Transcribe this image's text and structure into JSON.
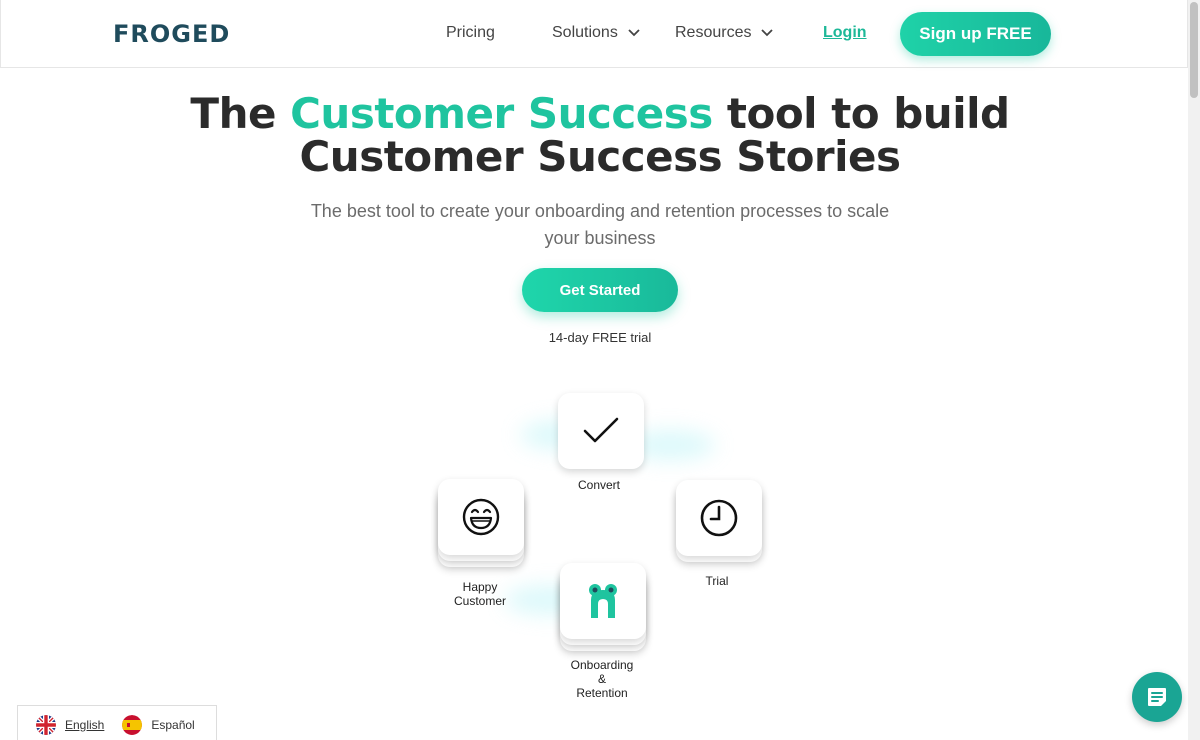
{
  "brand": {
    "name": "FROGED",
    "accent": "#1fc49f",
    "dark": "#1f4b5c"
  },
  "nav": {
    "pricing": "Pricing",
    "solutions": "Solutions",
    "resources": "Resources",
    "login": "Login",
    "signup": "Sign up FREE"
  },
  "hero": {
    "title_before": "The ",
    "title_accent": "Customer Success",
    "title_after": " tool to build",
    "title_line2": "Customer Success Stories",
    "subtitle": "The best tool to create your onboarding and retention processes to scale your business",
    "cta": "Get Started",
    "trial_note": "14-day FREE trial"
  },
  "cycle": {
    "convert": {
      "label": "Convert",
      "icon": "check-icon"
    },
    "trial": {
      "label": "Trial",
      "icon": "clock-icon"
    },
    "onboarding": {
      "label_line1": "Onboarding",
      "label_line2": "&",
      "label_line3": "Retention",
      "icon": "froged-frog-icon"
    },
    "happy": {
      "label_line1": "Happy",
      "label_line2": "Customer",
      "icon": "grinning-face-icon"
    }
  },
  "languages": [
    {
      "label": "English",
      "flag": "uk-flag-icon"
    },
    {
      "label": "Español",
      "flag": "spain-flag-icon"
    }
  ],
  "chat": {
    "icon": "chat-icon"
  }
}
